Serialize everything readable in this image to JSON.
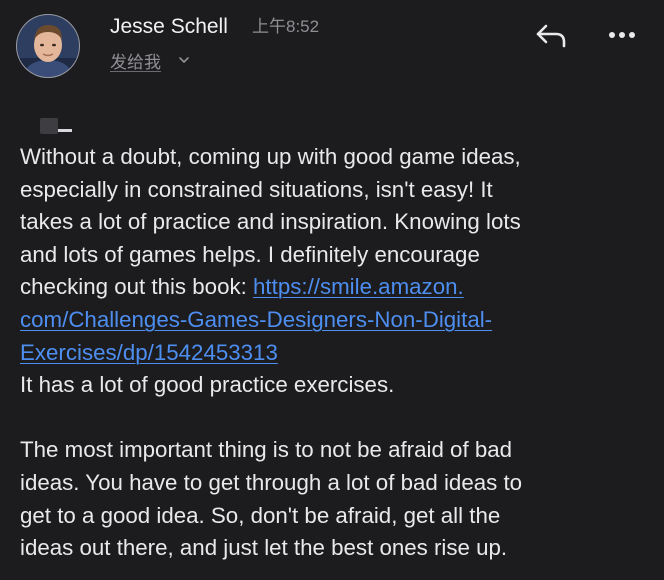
{
  "header": {
    "sender_name": "Jesse Schell",
    "time": "上午8:52",
    "recipient": "发给我",
    "reply_icon": "reply-icon",
    "more_icon": "more-horizontal-icon"
  },
  "message": {
    "paragraph_1": {
      "lines": [
        "Without a doubt, coming up with good game ideas,",
        "especially in constrained situations, isn't easy! It",
        "takes a lot of practice and inspiration. Knowing lots",
        "and lots of games helps. I definitely encourage"
      ],
      "line5_prefix": "checking out this book: ",
      "link_line1": "https://smile.amazon.",
      "link_line2": "com/Challenges-Games-Designers-Non-Digital-",
      "link_line3": "Exercises/dp/1542453313",
      "after_link": "It has a lot of good practice exercises."
    },
    "paragraph_2": {
      "lines": [
        "The most important thing is to not be afraid of bad",
        "ideas. You have to get through a lot of bad ideas to",
        "get to a good idea. So, don't be afraid, get all the",
        "ideas out there, and just let the best ones rise up."
      ]
    }
  },
  "colors": {
    "background": "#1c1c1e",
    "text": "#e9e9ec",
    "muted": "#8e8e93",
    "link": "#4d8ef0"
  }
}
